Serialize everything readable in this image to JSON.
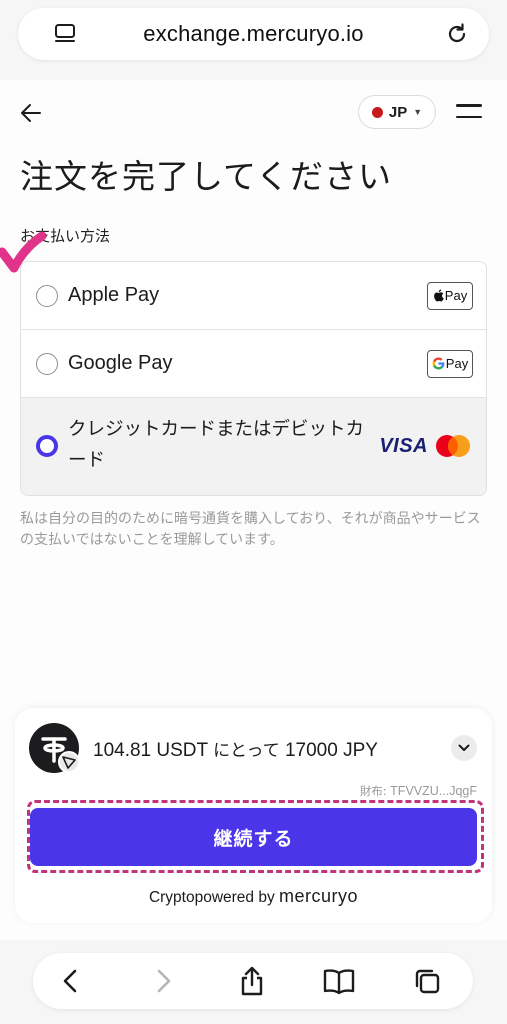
{
  "browser": {
    "url": "exchange.mercuryo.io",
    "icons": {
      "tabs": "tabs-list-icon",
      "reload": "reload-icon"
    }
  },
  "header": {
    "back_icon": "back-arrow-icon",
    "language": "JP",
    "language_flag_color": "#c81a1a",
    "menu_icon": "hamburger-menu-icon"
  },
  "page": {
    "title": "注文を完了してください",
    "section_label": "お支払い方法"
  },
  "payment_methods": [
    {
      "label": "Apple Pay",
      "badge": "Pay",
      "selected": false
    },
    {
      "label": "Google Pay",
      "badge": "Pay",
      "selected": false
    },
    {
      "label": "クレジットカードまたはデビットカード",
      "badge": "VISA",
      "selected": true
    }
  ],
  "disclaimer": "私は自分の目的のために暗号通貨を購入しており、それが商品やサービスの支払いではないことを理解しています。",
  "order": {
    "amount": "104.81 USDT",
    "for_text": "にとって",
    "price": "17000 JPY",
    "wallet_label": "財布:",
    "wallet_address": "TFVVZU...JqgF",
    "continue_label": "継続する",
    "powered_prefix": "Cryptopowered by",
    "powered_brand": "mercuryo"
  },
  "colors": {
    "accent": "#4a36e8",
    "highlight": "#c2347a",
    "visa": "#1a1f71"
  }
}
